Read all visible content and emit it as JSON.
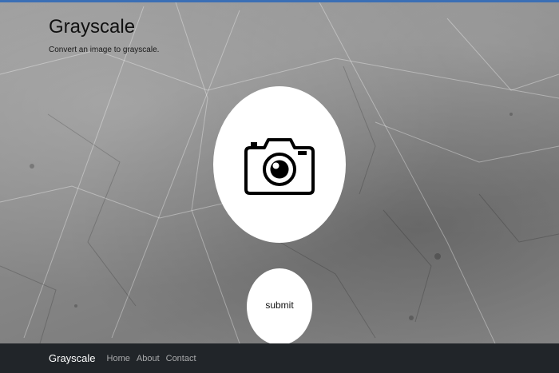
{
  "header": {
    "title": "Grayscale",
    "subtitle": "Convert an image to grayscale."
  },
  "upload": {
    "icon": "camera-icon"
  },
  "form": {
    "submit_label": "submit"
  },
  "navbar": {
    "brand": "Grayscale",
    "links": [
      "Home",
      "About",
      "Contact"
    ]
  },
  "colors": {
    "navbar_bg": "#212529",
    "top_accent": "#3b6fb5",
    "circle_bg": "#ffffff"
  }
}
